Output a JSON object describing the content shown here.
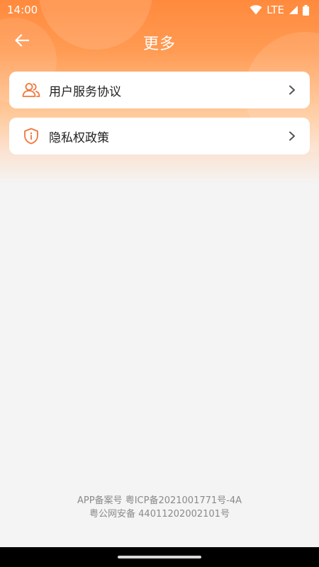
{
  "status_bar": {
    "time": "14:00",
    "network": "LTE"
  },
  "nav": {
    "title": "更多"
  },
  "menu": {
    "items": [
      {
        "label": "用户服务协议",
        "icon": "users-icon"
      },
      {
        "label": "隐私权政策",
        "icon": "shield-info-icon"
      }
    ]
  },
  "footer": {
    "line1": "APP备案号 粤ICP备2021001771号-4A",
    "line2": "粤公网安备 44011202002101号"
  },
  "colors": {
    "accent": "#ff8a3d",
    "icon": "#f0773a"
  }
}
